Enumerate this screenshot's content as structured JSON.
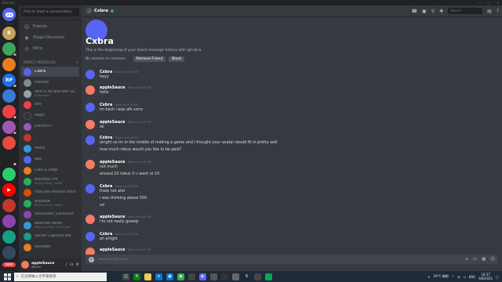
{
  "window": {
    "title": "Discord",
    "controls": [
      "—",
      "▢",
      "✕"
    ]
  },
  "guild_badges": {
    "g2": "1",
    "g4": "2",
    "g6": "2",
    "g7": "1",
    "g8": "5",
    "new": "NEW"
  },
  "sidebar": {
    "search_placeholder": "Find or start a conversation",
    "nav": [
      {
        "label": "Friends"
      },
      {
        "label": "Stage Discovery"
      },
      {
        "label": "Nitro"
      }
    ],
    "dm_header": "DIRECT MESSAGES",
    "dm_add": "+",
    "dms": [
      {
        "name": "Cxbra",
        "sub": ""
      },
      {
        "name": "mensss",
        "sub": ""
      },
      {
        "name": "lwin is ob and onfl su...",
        "sub": "6 Members"
      },
      {
        "name": "sn9",
        "sub": ""
      },
      {
        "name": "Major",
        "sub": ""
      },
      {
        "name": "ElectroYT",
        "sub": ""
      },
      {
        "name": "..",
        "sub": ""
      },
      {
        "name": "MEE6",
        "sub": ""
      },
      {
        "name": "dad",
        "sub": ""
      },
      {
        "name": "Cats & Dogs",
        "sub": ""
      },
      {
        "name": "Blocblok Pro",
        "sub": "Playing Tetip | Stella"
      },
      {
        "name": "fuck you mother bitch",
        "sub": ""
      },
      {
        "name": "Blocblok",
        "sub": "Playing Tetip | Stella"
      },
      {
        "name": "xxxXGaav_GoraXxxx",
        "sub": ""
      },
      {
        "name": "Reaction Roles",
        "sub": "Playing rr/help | 8 Hospital"
      },
      {
        "name": "Server Captcha Bot",
        "sub": ""
      },
      {
        "name": "Auriaree",
        "sub": ""
      }
    ],
    "user": {
      "name": "appleSauce",
      "tag": "#6134"
    }
  },
  "header": {
    "at_symbol": "@",
    "channel_name": "Cxbra",
    "search_placeholder": "Search"
  },
  "intro": {
    "title": "Cxbra",
    "description": "This is the beginning of your direct message history with @Cxbra.",
    "no_servers": "No servers in common",
    "remove_friend": "Remove Friend",
    "block": "Block"
  },
  "messages": [
    {
      "author": "Cxbra",
      "time": "Today at 6:44 PM",
      "lines": [
        "heyy"
      ]
    },
    {
      "author": "appleSauce",
      "time": "Today at 6:44 PM",
      "lines": [
        "hello"
      ]
    },
    {
      "author": "Cxbra",
      "time": "Today at 6:44 PM",
      "lines": [
        "im back i was afk sorry"
      ]
    },
    {
      "author": "appleSauce",
      "time": "Today at 6:44 PM",
      "lines": [
        "ok"
      ]
    },
    {
      "author": "Cxbra",
      "time": "Today at 6:45 PM",
      "lines": [
        "alright so im in the middle of making a game and i thought your avatar would fit in pretty well",
        "how much robux would you like to be paid?"
      ]
    },
    {
      "author": "appleSauce",
      "time": "Today at 6:46 PM",
      "lines": [
        "not much",
        "around 20 robux if u want or 10"
      ]
    },
    {
      "author": "Cxbra",
      "time": "Today at 6:46 PM",
      "lines": [
        "thats not alot",
        "i was thinking above 500",
        "xd"
      ]
    },
    {
      "author": "appleSauce",
      "time": "Today at 6:46 PM",
      "lines": [
        "i'm not really greedy"
      ]
    },
    {
      "author": "Cxbra",
      "time": "Today at 6:47 PM",
      "lines": [
        "ah alright"
      ]
    },
    {
      "author": "appleSauce",
      "time": "Today at 6:47 PM",
      "lines": []
    }
  ],
  "composer": {
    "placeholder": "Message @Cxbra"
  },
  "taskbar": {
    "search_placeholder": "在這裡輸入文字來搜尋",
    "weather": "29°C 晴朗",
    "lang": "ENG",
    "time": "18:37",
    "date": "6/8/2021"
  }
}
